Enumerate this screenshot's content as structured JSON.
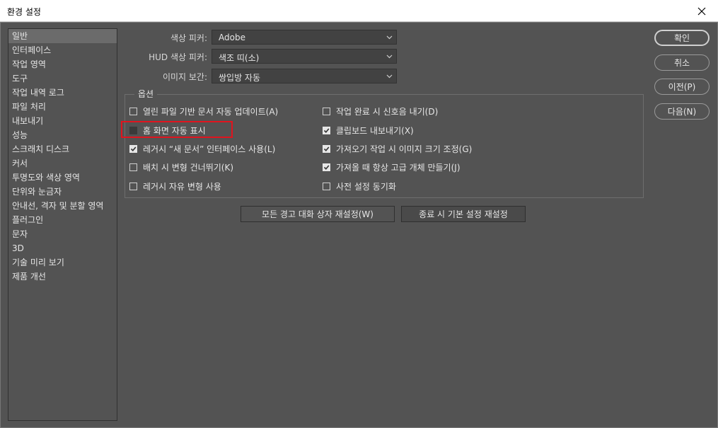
{
  "window": {
    "title": "환경 설정"
  },
  "sidebar": {
    "items": [
      {
        "label": "일반",
        "selected": true
      },
      {
        "label": "인터페이스"
      },
      {
        "label": "작업 영역"
      },
      {
        "label": "도구"
      },
      {
        "label": "작업 내역 로그"
      },
      {
        "label": "파일 처리"
      },
      {
        "label": "내보내기"
      },
      {
        "label": "성능"
      },
      {
        "label": "스크래치 디스크"
      },
      {
        "label": "커서"
      },
      {
        "label": "투명도와 색상 영역"
      },
      {
        "label": "단위와 눈금자"
      },
      {
        "label": "안내선, 격자 및 분할 영역"
      },
      {
        "label": "플러그인"
      },
      {
        "label": "문자"
      },
      {
        "label": "3D"
      },
      {
        "label": "기술 미리 보기"
      },
      {
        "label": "제품 개선"
      }
    ]
  },
  "settings": {
    "color_picker": {
      "label": "색상 피커:",
      "value": "Adobe"
    },
    "hud_color_picker": {
      "label": "HUD 색상 피커:",
      "value": "색조 띠(소)"
    },
    "image_interpolation": {
      "label": "이미지 보간:",
      "value": "쌍입방 자동"
    }
  },
  "options": {
    "legend": "옵션",
    "left": [
      {
        "label": "열린 파일 기반 문서 자동 업데이트(A)",
        "checked": false
      },
      {
        "label": "홈 화면 자동 표시",
        "checked": false
      },
      {
        "label": "레거시 “새 문서” 인터페이스 사용(L)",
        "checked": true
      },
      {
        "label": "배치 시 변형 건너뛰기(K)",
        "checked": false
      },
      {
        "label": "레거시 자유 변형 사용",
        "checked": false
      }
    ],
    "right": [
      {
        "label": "작업 완료 시 신호음 내기(D)",
        "checked": false
      },
      {
        "label": "클립보드 내보내기(X)",
        "checked": true
      },
      {
        "label": "가져오기 작업 시 이미지 크기 조정(G)",
        "checked": true
      },
      {
        "label": "가져올 때 항상 고급 개체 만들기(J)",
        "checked": true
      },
      {
        "label": "사전 설정 동기화",
        "checked": false
      }
    ]
  },
  "buttons": {
    "reset_warnings": "모든 경고 대화 상자 재설정(W)",
    "reset_on_quit": "종료 시 기본 설정 재설정",
    "ok": "확인",
    "cancel": "취소",
    "prev": "이전(P)",
    "next": "다음(N)"
  },
  "colors": {
    "background": "#535353",
    "highlight": "#e0141e",
    "field": "#424242"
  }
}
